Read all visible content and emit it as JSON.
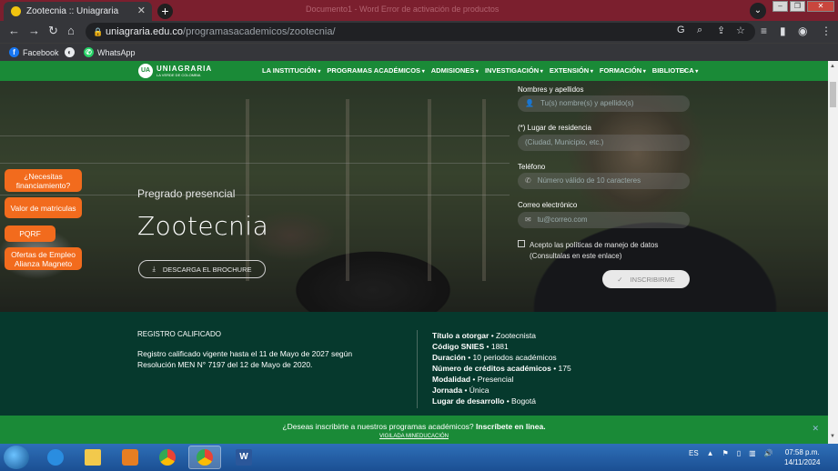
{
  "browser": {
    "tab_title": "Zootecnia :: Uniagraria",
    "tab_close": "✕",
    "new_tab": "+",
    "background_tab_title": "Documento1 - Word    Error de activación de productos",
    "url_host": "uniagraria.edu.co",
    "url_path": "/programasacademicos/zootecnia/",
    "bookmarks": [
      {
        "label": "Facebook",
        "icon": "facebook-icon"
      },
      {
        "label": "",
        "icon": "globe-icon"
      },
      {
        "label": "WhatsApp",
        "icon": "whatsapp-icon"
      }
    ]
  },
  "site": {
    "logo_name": "UNIAGRARIA",
    "logo_sub": "LA VERDE DE COLOMBIA",
    "menu": [
      "LA INSTITUCIÓN",
      "PROGRAMAS ACADÉMICOS",
      "ADMISIONES",
      "INVESTIGACIÓN",
      "EXTENSIÓN",
      "FORMACIÓN",
      "BIBLIOTECA"
    ]
  },
  "hero": {
    "kicker": "Pregrado presencial",
    "title": "Zootecnia",
    "brochure_label": "DESCARGA EL BROCHURE"
  },
  "side_buttons": [
    "¿Necesitas financiamiento?",
    "Valor de matriculas",
    "PQRF",
    "Ofertas de Empleo Alianza Magneto"
  ],
  "form": {
    "name_label": "Nombres y apellidos",
    "name_placeholder": "Tu(s) nombre(s) y apellido(s)",
    "residence_label": "(*) Lugar de residencia",
    "residence_placeholder": "(Ciudad, Municipio, etc.)",
    "phone_label": "Teléfono",
    "phone_placeholder": "Número válido de 10 caracteres",
    "email_label": "Correo electrónico",
    "email_placeholder": "tu@correo.com",
    "consent_line1": "Acepto las políticas de manejo de datos",
    "consent_line2": "(Consultalas en este enlace)",
    "submit_label": "INSCRIBIRME"
  },
  "info": {
    "rc_title": "REGISTRO CALIFICADO",
    "rc_text": "Registro calificado vigente hasta el 11 de Mayo de 2027 según Resolución MEN N° 7197 del 12 de Mayo de 2020.",
    "facts": [
      {
        "k": "Título a otorgar",
        "v": " • Zootecnista"
      },
      {
        "k": "Código SNIES",
        "v": " • 1881"
      },
      {
        "k": "Duración",
        "v": " • 10 periodos académicos"
      },
      {
        "k": "Número de créditos académicos",
        "v": " • 175"
      },
      {
        "k": "Modalidad",
        "v": " • Presencial"
      },
      {
        "k": "Jornada",
        "v": " • Única"
      },
      {
        "k": "Lugar de desarrollo",
        "v": " • Bogotá"
      }
    ]
  },
  "banner": {
    "text": "¿Deseas inscribirte a nuestros programas académicos?",
    "cta": "Inscríbete en linea.",
    "link": "VIGILADA MINEDUCACIÓN",
    "close": "✕"
  },
  "taskbar": {
    "lang": "ES",
    "time": "07:58 p.m.",
    "date": "14/11/2024"
  }
}
